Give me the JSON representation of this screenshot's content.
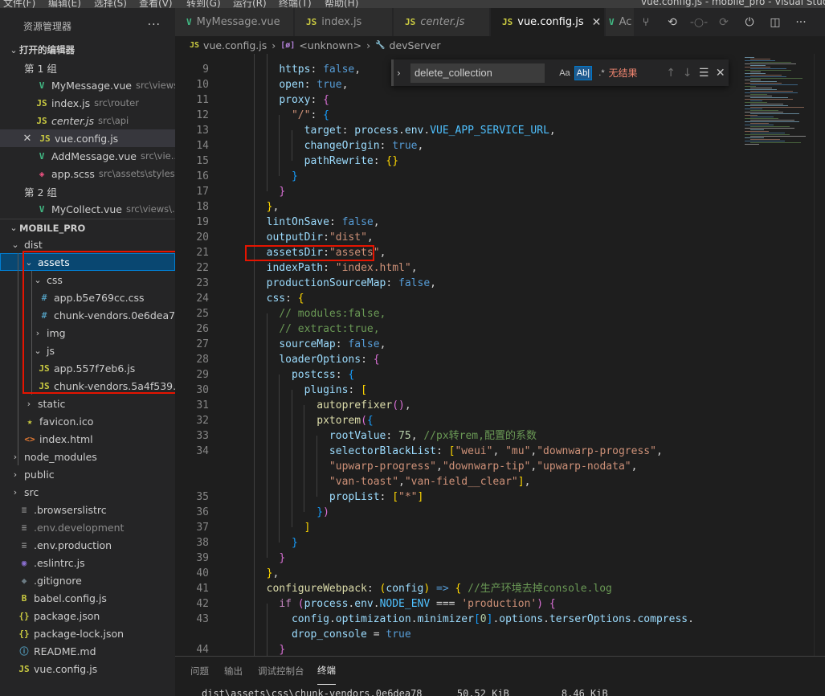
{
  "menubar": {
    "items": [
      "文件(F)",
      "编辑(E)",
      "选择(S)",
      "查看(V)",
      "转到(G)",
      "运行(R)",
      "终端(T)",
      "帮助(H)"
    ],
    "window_title": "vue.config.js - mobile_pro - Visual Studio Code"
  },
  "sidebar": {
    "title": "资源管理器",
    "more_icon": "ellipsis-icon",
    "open_editors_title": "打开的编辑器",
    "group1_label": "第 1 组",
    "group2_label": "第 2 组",
    "open_editors": [
      {
        "name": "MyMessage.vue",
        "desc": "src\\views\\...",
        "icon": "vue-icon",
        "group": 1
      },
      {
        "name": "index.js",
        "desc": "src\\router",
        "icon": "js-icon",
        "group": 1
      },
      {
        "name": "center.js",
        "desc": "src\\api",
        "icon": "js-icon",
        "group": 1,
        "italic": true
      },
      {
        "name": "vue.config.js",
        "desc": "",
        "icon": "js-icon",
        "group": 1,
        "active": true
      },
      {
        "name": "AddMessage.vue",
        "desc": "src\\vie...",
        "icon": "vue-icon",
        "group": 1
      },
      {
        "name": "app.scss",
        "desc": "src\\assets\\styles",
        "icon": "scss-icon",
        "group": 1
      },
      {
        "name": "MyCollect.vue",
        "desc": "src\\views\\...",
        "icon": "vue-icon",
        "group": 2
      }
    ],
    "project_title": "MOBILE_PRO",
    "tree": [
      {
        "name": "dist",
        "type": "folder",
        "open": true,
        "depth": 1
      },
      {
        "name": "assets",
        "type": "folder",
        "open": true,
        "depth": 2,
        "selected": true
      },
      {
        "name": "css",
        "type": "folder",
        "open": true,
        "depth": 3
      },
      {
        "name": "app.b5e769cc.css",
        "type": "css",
        "depth": 4
      },
      {
        "name": "chunk-vendors.0e6dea7...",
        "type": "css",
        "depth": 4
      },
      {
        "name": "img",
        "type": "folder",
        "open": false,
        "depth": 3
      },
      {
        "name": "js",
        "type": "folder",
        "open": true,
        "depth": 3
      },
      {
        "name": "app.557f7eb6.js",
        "type": "js",
        "depth": 4
      },
      {
        "name": "chunk-vendors.5a4f539...",
        "type": "js",
        "depth": 4
      },
      {
        "name": "static",
        "type": "folder",
        "open": false,
        "depth": 2
      },
      {
        "name": "favicon.ico",
        "type": "star",
        "depth": 2
      },
      {
        "name": "index.html",
        "type": "html",
        "depth": 2
      },
      {
        "name": "node_modules",
        "type": "folder",
        "open": false,
        "depth": 1
      },
      {
        "name": "public",
        "type": "folder",
        "open": false,
        "depth": 1
      },
      {
        "name": "src",
        "type": "folder",
        "open": false,
        "depth": 1
      },
      {
        "name": ".browserslistrc",
        "type": "text",
        "depth": 1
      },
      {
        "name": ".env.development",
        "type": "text",
        "depth": 1
      },
      {
        "name": ".env.production",
        "type": "text",
        "depth": 1
      },
      {
        "name": ".eslintrc.js",
        "type": "eslint",
        "depth": 1
      },
      {
        "name": ".gitignore",
        "type": "git",
        "depth": 1
      },
      {
        "name": "babel.config.js",
        "type": "babel",
        "depth": 1
      },
      {
        "name": "package.json",
        "type": "json",
        "depth": 1
      },
      {
        "name": "package-lock.json",
        "type": "json",
        "depth": 1
      },
      {
        "name": "README.md",
        "type": "readme",
        "depth": 1
      },
      {
        "name": "vue.config.js",
        "type": "js",
        "depth": 1
      }
    ]
  },
  "tabs": [
    {
      "label": "MyMessage.vue",
      "icon": "vue-icon"
    },
    {
      "label": "index.js",
      "icon": "js-icon"
    },
    {
      "label": "center.js",
      "icon": "js-icon",
      "italic": true
    },
    {
      "label": "vue.config.js",
      "icon": "js-icon",
      "active": true
    },
    {
      "label": "Ac",
      "icon": "vue-icon"
    }
  ],
  "tab_actions": [
    "source-control-icon",
    "go-back-icon",
    "go-dot-icon",
    "go-forward-icon",
    "run-icon",
    "split-editor-icon",
    "more-icon"
  ],
  "breadcrumb": {
    "file": "vue.config.js",
    "symbol": "<unknown>",
    "property": "devServer"
  },
  "find": {
    "query": "delete_collection",
    "case_label": "Aa",
    "word_label": "Ab|",
    "regex_label": ".*",
    "result": "无结果"
  },
  "code_lines": [
    {
      "n": "9",
      "html": "    <span class='k'>https</span><span class='p'>: </span><span class='b'>false</span><span class='p'>,</span>"
    },
    {
      "n": "10",
      "html": "    <span class='k'>open</span><span class='p'>: </span><span class='b'>true</span><span class='p'>,</span>"
    },
    {
      "n": "11",
      "html": "    <span class='k'>proxy</span><span class='p'>: </span><span class='br2'>{</span>"
    },
    {
      "n": "12",
      "html": "      <span class='s'>\"/\"</span><span class='p'>: </span><span class='br3'>{</span>"
    },
    {
      "n": "13",
      "html": "        <span class='k'>target</span><span class='p'>: </span><span class='k'>process</span><span class='p'>.</span><span class='k'>env</span><span class='p'>.</span><span class='v'>VUE_APP_SERVICE_URL</span><span class='p'>,</span>"
    },
    {
      "n": "14",
      "html": "        <span class='k'>changeOrigin</span><span class='p'>: </span><span class='b'>true</span><span class='p'>,</span>"
    },
    {
      "n": "15",
      "html": "        <span class='k'>pathRewrite</span><span class='p'>: </span><span class='br1'>{}</span>"
    },
    {
      "n": "16",
      "html": "      <span class='br3'>}</span>"
    },
    {
      "n": "17",
      "html": "    <span class='br2'>}</span>"
    },
    {
      "n": "18",
      "html": "  <span class='br1'>}</span><span class='p'>,</span>"
    },
    {
      "n": "19",
      "html": "  <span class='k'>lintOnSave</span><span class='p'>: </span><span class='b'>false</span><span class='p'>,</span>"
    },
    {
      "n": "20",
      "html": "  <span class='k'>outputDir</span><span class='p'>:</span><span class='s'>\"dist\"</span><span class='p'>,</span>"
    },
    {
      "n": "21",
      "html": "  <span class='k'>assetsDir</span><span class='p'>:</span><span class='s'>\"assets\"</span><span class='p'>,</span>"
    },
    {
      "n": "22",
      "html": "  <span class='k'>indexPath</span><span class='p'>: </span><span class='s'>\"index.html\"</span><span class='p'>,</span>"
    },
    {
      "n": "23",
      "html": "  <span class='k'>productionSourceMap</span><span class='p'>: </span><span class='b'>false</span><span class='p'>,</span>"
    },
    {
      "n": "24",
      "html": "  <span class='k'>css</span><span class='p'>: </span><span class='br1'>{</span>"
    },
    {
      "n": "25",
      "html": "    <span class='c'>// modules:false,</span>"
    },
    {
      "n": "26",
      "html": "    <span class='c'>// extract:true,</span>"
    },
    {
      "n": "27",
      "html": "    <span class='k'>sourceMap</span><span class='p'>: </span><span class='b'>false</span><span class='p'>,</span>"
    },
    {
      "n": "28",
      "html": "    <span class='k'>loaderOptions</span><span class='p'>: </span><span class='br2'>{</span>"
    },
    {
      "n": "29",
      "html": "      <span class='k'>postcss</span><span class='p'>: </span><span class='br3'>{</span>"
    },
    {
      "n": "30",
      "html": "        <span class='k'>plugins</span><span class='p'>: </span><span class='br1'>[</span>"
    },
    {
      "n": "31",
      "html": "          <span class='f'>autoprefixer</span><span class='br2'>()</span><span class='p'>,</span>"
    },
    {
      "n": "32",
      "html": "          <span class='f'>pxtorem</span><span class='br2'>(</span><span class='br3'>{</span>"
    },
    {
      "n": "33",
      "html": "            <span class='k'>rootValue</span><span class='p'>: </span><span class='n'>75</span><span class='p'>, </span><span class='c'>//px转rem,配置的系数</span>"
    },
    {
      "n": "34",
      "html": "            <span class='k'>selectorBlackList</span><span class='p'>: </span><span class='br1'>[</span><span class='s'>\"weui\"</span><span class='p'>, </span><span class='s'>\"mu\"</span><span class='p'>,</span><span class='s'>\"downwarp-progress\"</span><span class='p'>,</span>"
    },
    {
      "n": "",
      "html": "            <span class='s'>\"upwarp-progress\"</span><span class='p'>,</span><span class='s'>\"downwarp-tip\"</span><span class='p'>,</span><span class='s'>\"upwarp-nodata\"</span><span class='p'>,</span>"
    },
    {
      "n": "",
      "html": "            <span class='s'>\"van-toast\"</span><span class='p'>,</span><span class='s'>\"van-field__clear\"</span><span class='br1'>]</span><span class='p'>,</span>"
    },
    {
      "n": "35",
      "html": "            <span class='k'>propList</span><span class='p'>: </span><span class='br1'>[</span><span class='s'>\"*\"</span><span class='br1'>]</span>"
    },
    {
      "n": "36",
      "html": "          <span class='br3'>}</span><span class='br2'>)</span>"
    },
    {
      "n": "37",
      "html": "        <span class='br1'>]</span>"
    },
    {
      "n": "38",
      "html": "      <span class='br3'>}</span>"
    },
    {
      "n": "39",
      "html": "    <span class='br2'>}</span>"
    },
    {
      "n": "40",
      "html": "  <span class='br1'>}</span><span class='p'>,</span>"
    },
    {
      "n": "41",
      "html": "  <span class='f'>configureWebpack</span><span class='p'>: </span><span class='br1'>(</span><span class='k'>config</span><span class='br1'>)</span><span class='p'> </span><span class='b'>=&gt;</span><span class='p'> </span><span class='br1'>{</span><span class='p'> </span><span class='c'>//生产环境去掉console.log</span>"
    },
    {
      "n": "42",
      "html": "    <span class='kw'>if</span><span class='p'> </span><span class='br2'>(</span><span class='k'>process</span><span class='p'>.</span><span class='k'>env</span><span class='p'>.</span><span class='v'>NODE_ENV</span><span class='p'> === </span><span class='s'>'production'</span><span class='br2'>)</span><span class='p'> </span><span class='br2'>{</span>"
    },
    {
      "n": "43",
      "html": "      <span class='k'>config</span><span class='p'>.</span><span class='k'>optimization</span><span class='p'>.</span><span class='k'>minimizer</span><span class='br3'>[</span><span class='n'>0</span><span class='br3'>]</span><span class='p'>.</span><span class='k'>options</span><span class='p'>.</span><span class='k'>terserOptions</span><span class='p'>.</span><span class='k'>compress</span><span class='p'>.</span>"
    },
    {
      "n": "",
      "html": "      <span class='k'>drop_console</span><span class='p'> = </span><span class='b'>true</span>"
    },
    {
      "n": "44",
      "html": "    <span class='br2'>}</span>"
    }
  ],
  "panel": {
    "tabs": [
      "问题",
      "输出",
      "调试控制台",
      "终端"
    ],
    "active_tab": "终端",
    "terminal_line": "dist\\assets\\css\\chunk-vendors.0e6dea78      50.52 KiB         8.46 KiB"
  },
  "colors": {
    "highlight_box": "#e51400",
    "selection": "#094771",
    "accent": "#007acc"
  }
}
